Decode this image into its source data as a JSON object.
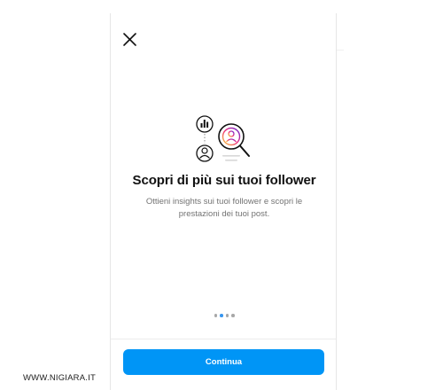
{
  "dialog": {
    "close_icon": "close-icon",
    "illustration_icons": [
      "bar-chart-icon",
      "person-icon",
      "magnifier-icon"
    ],
    "title": "Scopri di più sui tuoi follower",
    "subtitle": "Ottieni insights sui tuoi follower e scopri le prestazioni dei tuoi post.",
    "pagination": {
      "total": 4,
      "active_index": 1
    },
    "continue_label": "Continua"
  },
  "watermark": "WWW.NIGIARA.IT",
  "colors": {
    "accent": "#0095f6",
    "dot_active": "#3897f0",
    "dot_inactive": "#a8a8a8",
    "title_text": "#111111",
    "subtitle_text": "#737373",
    "instagram_gradient": [
      "#f9ce34",
      "#ee2a7b",
      "#6228d7"
    ]
  }
}
